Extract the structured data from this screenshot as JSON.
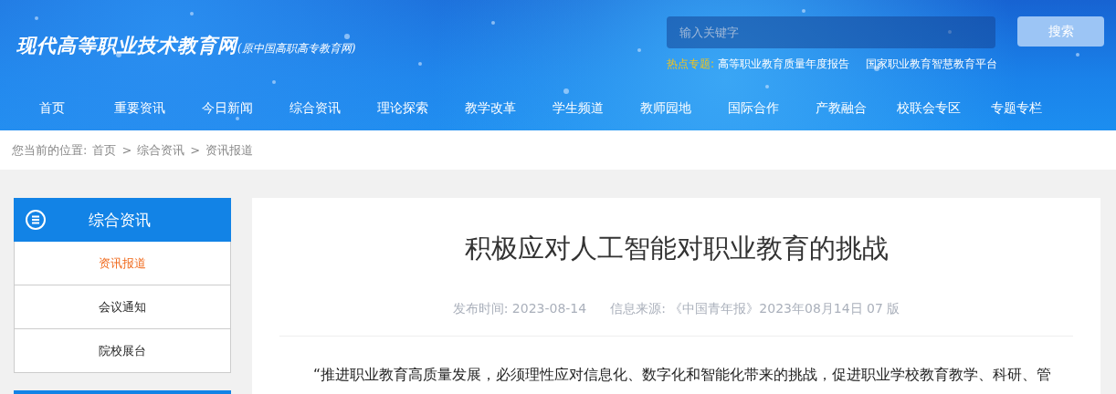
{
  "site": {
    "title": "现代高等职业技术教育网",
    "subtitle": "(原中国高职高专教育网)"
  },
  "search": {
    "placeholder": "输入关键字",
    "button": "搜索"
  },
  "hot_topics": {
    "label": "热点专题:",
    "links": [
      "高等职业教育质量年度报告",
      "国家职业教育智慧教育平台"
    ]
  },
  "nav": [
    {
      "label": "首页"
    },
    {
      "label": "重要资讯"
    },
    {
      "label": "今日新闻"
    },
    {
      "label": "综合资讯"
    },
    {
      "label": "理论探索"
    },
    {
      "label": "教学改革"
    },
    {
      "label": "学生频道"
    },
    {
      "label": "教师园地"
    },
    {
      "label": "国际合作"
    },
    {
      "label": "产教融合"
    },
    {
      "label": "校联会专区"
    },
    {
      "label": "专题专栏"
    }
  ],
  "breadcrumb": {
    "label": "您当前的位置:",
    "items": [
      "首页",
      "综合资讯",
      "资讯报道"
    ],
    "separator": ">"
  },
  "sidebar": {
    "title": "综合资讯",
    "items": [
      {
        "label": "资讯报道",
        "selected": true
      },
      {
        "label": "会议通知",
        "selected": false
      },
      {
        "label": "院校展台",
        "selected": false
      }
    ]
  },
  "article": {
    "title": "积极应对人工智能对职业教育的挑战",
    "date_label": "发布时间:",
    "date": "2023-08-14",
    "source_label": "信息来源:",
    "source": "《中国青年报》2023年08月14日 07 版",
    "body": "“推进职业教育高质量发展，必须理性应对信息化、数字化和智能化带来的挑战，促进职业学校教育教学、科研、管"
  }
}
